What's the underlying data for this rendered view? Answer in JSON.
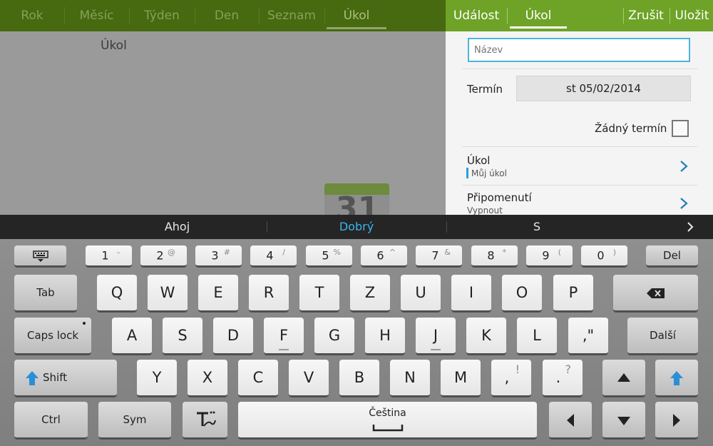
{
  "calendar": {
    "view_tabs": [
      "Rok",
      "Měsíc",
      "Týden",
      "Den",
      "Seznam",
      "Úkol"
    ],
    "heading": "Úkol",
    "empty_icon_number": "31"
  },
  "editor": {
    "tabs": [
      "Událost",
      "Úkol"
    ],
    "cancel_label": "Zrušit",
    "save_label": "Uložit",
    "title_placeholder": "Název",
    "due_label": "Termín",
    "due_value": "st 05/02/2014",
    "no_due_label": "Žádný termín",
    "task_row_label": "Úkol",
    "task_row_value": "Můj úkol",
    "reminder_label": "Připomenutí",
    "reminder_value": "Vypnout"
  },
  "suggestions": [
    "Ahoj",
    "Dobrý",
    "S"
  ],
  "keyboard": {
    "number_row": [
      {
        "main": "1",
        "sub": "–"
      },
      {
        "main": "2",
        "sub": "@"
      },
      {
        "main": "3",
        "sub": "#"
      },
      {
        "main": "4",
        "sub": "/"
      },
      {
        "main": "5",
        "sub": "%"
      },
      {
        "main": "6",
        "sub": "^"
      },
      {
        "main": "7",
        "sub": "&"
      },
      {
        "main": "8",
        "sub": "*"
      },
      {
        "main": "9",
        "sub": "("
      },
      {
        "main": "0",
        "sub": ")"
      }
    ],
    "del_label": "Del",
    "tab_label": "Tab",
    "row_q": [
      "Q",
      "W",
      "E",
      "R",
      "T",
      "Z",
      "U",
      "I",
      "O",
      "P"
    ],
    "caps_label": "Caps lock",
    "row_a": [
      "A",
      "S",
      "D",
      "F",
      "G",
      "H",
      "J",
      "K",
      "L"
    ],
    "comma_quote": ",\"",
    "next_label": "Další",
    "shift_label": "Shift",
    "row_y": [
      "Y",
      "X",
      "C",
      "V",
      "B",
      "N",
      "M"
    ],
    "comma_key": {
      "main": ",",
      "sub": "!"
    },
    "period_key": {
      "main": ".",
      "sub": "?"
    },
    "ctrl_label": "Ctrl",
    "sym_label": "Sym",
    "space_label": "Čeština"
  },
  "colors": {
    "accent_green": "#6ea327",
    "accent_blue": "#27a3d4",
    "focus_blue": "#4eb3dd"
  }
}
